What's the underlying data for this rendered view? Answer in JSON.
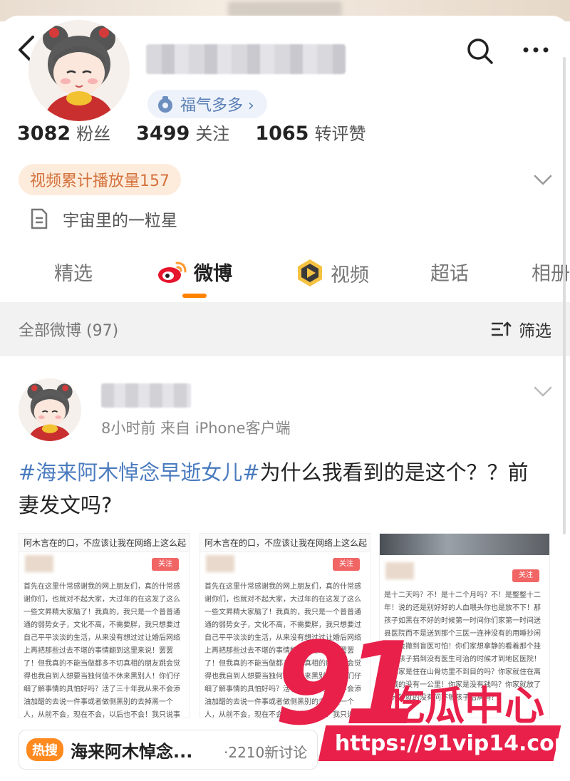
{
  "header": {
    "back_icon": "chevron-left-icon",
    "search_icon": "search-icon",
    "more_icon": "ellipsis-icon"
  },
  "profile": {
    "badge_label": "福气多多 ›",
    "stats": [
      {
        "num": "3082",
        "label": "粉丝"
      },
      {
        "num": "3499",
        "label": "关注"
      },
      {
        "num": "1065",
        "label": "转评赞"
      }
    ],
    "video_plays": "视频累计播放量157",
    "bio": "宇宙里的一粒星"
  },
  "tabs": [
    {
      "label": "精选"
    },
    {
      "label": "微博"
    },
    {
      "label": "视频"
    },
    {
      "label": "超话"
    },
    {
      "label": "相册"
    }
  ],
  "filter": {
    "count": "全部微博 (97)",
    "filter_label": "筛选"
  },
  "post": {
    "meta": "8小时前  来自 iPhone客户端",
    "topic": "#海来阿木悼念早逝女儿#",
    "text": "为什么我看到的是这个？？前妻发文吗?",
    "thumbs": [
      {
        "caption": "阿木言在的口，不应该让我在网络上这么起",
        "follow": "关注",
        "body": "首先在这里什常感谢我的网上朋友们，真的什常感谢你们，也就对不起大家，大过年的在这发了这么一些文昇精大家脑了！我真的，我只是一个普普通通的弱势女子，文化不高，不需要胖，我只想要过自己平平淡淡的生活，从来没有想过过让婚后网络上再把那些过去不堪的事情翻到这里来说！罢罢了！但我真的不能当做都多不切真相的朋友跳会觉得也我自到人想要当独何值不休来黑别人！你们仔细了解事情的具怕好吗？活了三十年我从来不会添油加醋的去说一件事或者做侧黑别的去掉黑一个人，从前不会，现在不会，以后也不会！我只说事实！如有恶语，我会负起我应负的法律责任！"
      },
      {
        "caption": "阿木言在的口，不应该让我在网络上这么起",
        "follow": "关注",
        "body": "首先在这里什常感谢我的网上朋友们，真的什常感谢你们，也就对不起大家，大过年的在这发了这么一些文昇精大家脑了！我真的，我只是一个普普通通的弱势女子，文化不高，不需要胖，我只想要过自己平平淡淡的生活，从来没有想过过让婚后网络上再把那些过去不堪的事情翻到这里来说！罢罢了！但我真的不能当做都多不切真相的朋友跳会觉得也我自到人想要当独何值不休来黑别人！你们仔细了解事情的具怕好吗？活了三十年我从来不会添油加醋的去说一件事或者做侧黑别的去掉黑一个人，从前不会，现在不会，以后也不会！我只说事实！如有恶语，我会负起我应负的法律责任！"
      },
      {
        "caption": "",
        "follow": "关注",
        "body": "是十二天吗？不！是十二个月吗？不！是整整十二年！说的还是别好好的人血喂头你也是放不下！那孩子如黑在不好的时候第一时间你们家第一时间送县医院而不是送到那个三医一连神没有的用睡抄闲就不会撤到盲医可怕！你们家想拿静的看着那个挂的病孩子捐到没有医生可治的时候才到地区医院！你们家是住在山骨坊里不到目的吗？你家就住在离县城的没有一公里！你家是没有钱吗？你家就放了三分钟就的没有问不够孩子治病吗？"
      }
    ],
    "hot_tag": "热搜",
    "hot_text": "海来阿木悼念...",
    "hot_count": "·2210新讨论"
  },
  "watermark": {
    "number": "91",
    "text": "吃瓜中心",
    "url": "https://91vip14.com"
  },
  "colors": {
    "accent": "#ff8200",
    "link": "#4a7bbf",
    "watermark": "#e8204a"
  }
}
